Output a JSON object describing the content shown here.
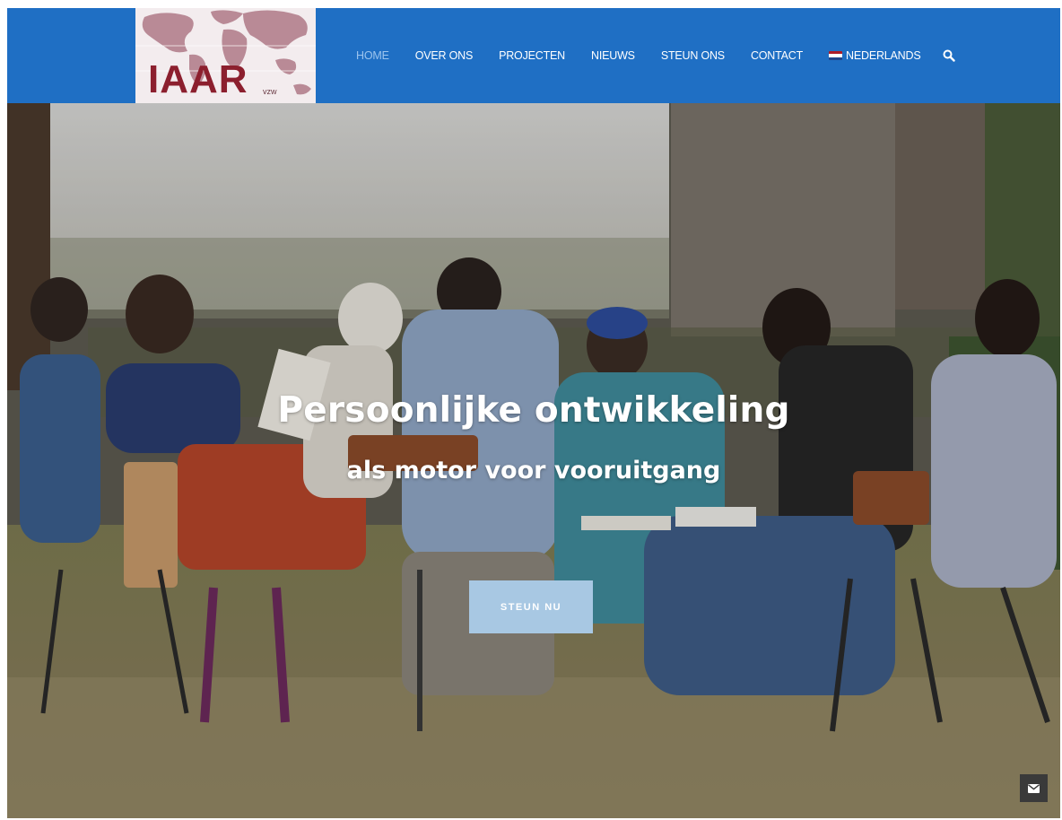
{
  "brand": {
    "logo_text": "IAAR",
    "logo_subtext": "vzw"
  },
  "nav": {
    "items": [
      {
        "label": "HOME",
        "active": true
      },
      {
        "label": "OVER ONS",
        "active": false
      },
      {
        "label": "PROJECTEN",
        "active": false
      },
      {
        "label": "NIEUWS",
        "active": false
      },
      {
        "label": "STEUN ONS",
        "active": false
      },
      {
        "label": "CONTACT",
        "active": false
      }
    ],
    "language": {
      "label": "NEDERLANDS",
      "icon": "flag-nl-icon"
    },
    "search_icon": "search-icon"
  },
  "hero": {
    "title": "Persoonlijke ontwikkeling",
    "subtitle": "als motor voor vooruitgang",
    "cta_label": "STEUN NU"
  },
  "floating": {
    "mail_icon": "envelope-icon"
  },
  "colors": {
    "header_bg": "#1f6fc4",
    "nav_active": "#9cc4ee",
    "cta_bg": "#a8c8e3",
    "logo_red": "#8c1f2e"
  }
}
